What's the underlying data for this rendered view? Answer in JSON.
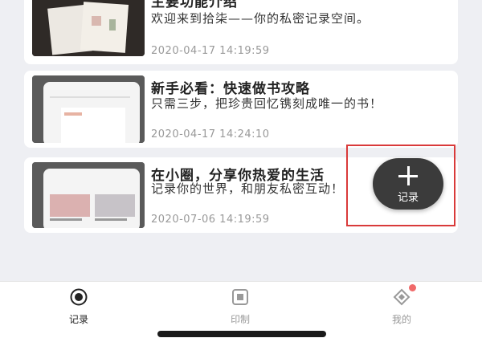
{
  "cards": [
    {
      "title": "主要功能介绍",
      "description": "欢迎来到拾柒——你的私密记录空间。",
      "timestamp": "2020-04-17 14:19:59"
    },
    {
      "title": "新手必看：快速做书攻略",
      "description": "只需三步，把珍贵回忆镌刻成唯一的书！",
      "timestamp": "2020-04-17 14:24:10"
    },
    {
      "title": "在小圈，分享你热爱的生活",
      "description": "记录你的世界，和朋友私密互动！",
      "timestamp": "2020-07-06 14:19:59"
    }
  ],
  "fab": {
    "label": "记录",
    "icon": "plus-icon"
  },
  "nav": [
    {
      "label": "记录",
      "icon": "record-icon",
      "active": true
    },
    {
      "label": "印制",
      "icon": "print-icon",
      "active": false
    },
    {
      "label": "我的",
      "icon": "profile-icon",
      "active": false,
      "badge": true
    }
  ],
  "colors": {
    "accent": "#222222",
    "highlight_box": "#d93a3a",
    "badge": "#f06a6a",
    "fab": "#3b3b3b"
  }
}
